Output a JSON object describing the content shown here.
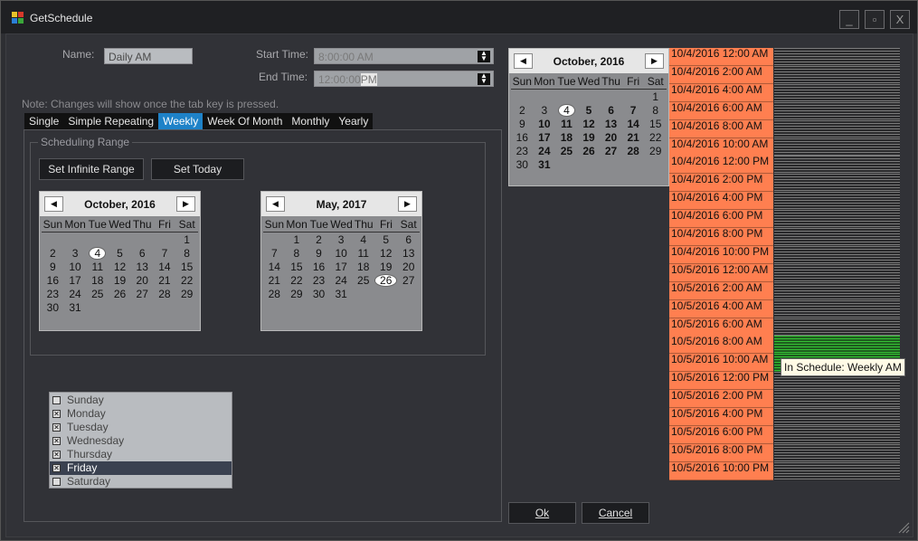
{
  "window": {
    "title": "GetSchedule",
    "minimize": "_",
    "restore": "▫",
    "close": "X"
  },
  "form": {
    "name_label": "Name:",
    "name_value": "Daily AM",
    "start_label": "Start Time:",
    "start_value": "8:00:00 AM",
    "end_label": "End Time:",
    "end_value": "12:00:00",
    "end_suffix": "PM",
    "note": "Note:  Changes will show once the tab key is pressed."
  },
  "tabs": [
    "Single",
    "Simple Repeating",
    "Weekly",
    "Week Of Month",
    "Monthly",
    "Yearly"
  ],
  "active_tab": "Weekly",
  "range": {
    "group_label": "Scheduling Range",
    "infinite_button": "Set Infinite Range",
    "today_button": "Set Today"
  },
  "dow": [
    "Sun",
    "Mon",
    "Tue",
    "Wed",
    "Thu",
    "Fri",
    "Sat"
  ],
  "calendars": {
    "start": {
      "title": "October, 2016",
      "days": [
        "",
        "",
        "",
        "",
        "",
        "",
        "1",
        "2",
        "3",
        "4",
        "5",
        "6",
        "7",
        "8",
        "9",
        "10",
        "11",
        "12",
        "13",
        "14",
        "15",
        "16",
        "17",
        "18",
        "19",
        "20",
        "21",
        "22",
        "23",
        "24",
        "25",
        "26",
        "27",
        "28",
        "29",
        "30",
        "31"
      ],
      "today": "4"
    },
    "end": {
      "title": "May, 2017",
      "days": [
        "",
        "1",
        "2",
        "3",
        "4",
        "5",
        "6",
        "7",
        "8",
        "9",
        "10",
        "11",
        "12",
        "13",
        "14",
        "15",
        "16",
        "17",
        "18",
        "19",
        "20",
        "21",
        "22",
        "23",
        "24",
        "25",
        "26",
        "27",
        "28",
        "29",
        "30",
        "31"
      ],
      "today": "26"
    },
    "preview": {
      "title": "October, 2016",
      "days": [
        "",
        "",
        "",
        "",
        "",
        "",
        "1",
        "2",
        "3",
        "4",
        "5",
        "6",
        "7",
        "8",
        "9",
        "10",
        "11",
        "12",
        "13",
        "14",
        "15",
        "16",
        "17",
        "18",
        "19",
        "20",
        "21",
        "22",
        "23",
        "24",
        "25",
        "26",
        "27",
        "28",
        "29",
        "30",
        "31"
      ],
      "today": "4",
      "bold": [
        "5",
        "6",
        "7",
        "10",
        "11",
        "12",
        "13",
        "14",
        "17",
        "18",
        "19",
        "20",
        "21",
        "24",
        "25",
        "26",
        "27",
        "28",
        "31"
      ]
    }
  },
  "weekdays": [
    {
      "label": "Sunday",
      "checked": false
    },
    {
      "label": "Monday",
      "checked": true
    },
    {
      "label": "Tuesday",
      "checked": true
    },
    {
      "label": "Wednesday",
      "checked": true
    },
    {
      "label": "Thursday",
      "checked": true
    },
    {
      "label": "Friday",
      "checked": true,
      "selected": true
    },
    {
      "label": "Saturday",
      "checked": false
    }
  ],
  "timeline": {
    "slots": [
      "10/4/2016 12:00 AM",
      "10/4/2016 2:00 AM",
      "10/4/2016 4:00 AM",
      "10/4/2016 6:00 AM",
      "10/4/2016 8:00 AM",
      "10/4/2016 10:00 AM",
      "10/4/2016 12:00 PM",
      "10/4/2016 2:00 PM",
      "10/4/2016 4:00 PM",
      "10/4/2016 6:00 PM",
      "10/4/2016 8:00 PM",
      "10/4/2016 10:00 PM",
      "10/5/2016 12:00 AM",
      "10/5/2016 2:00 AM",
      "10/5/2016 4:00 AM",
      "10/5/2016 6:00 AM",
      "10/5/2016 8:00 AM",
      "10/5/2016 10:00 AM",
      "10/5/2016 12:00 PM",
      "10/5/2016 2:00 PM",
      "10/5/2016 4:00 PM",
      "10/5/2016 6:00 PM",
      "10/5/2016 8:00 PM",
      "10/5/2016 10:00 PM"
    ],
    "in_schedule": [
      "10/5/2016 8:00 AM",
      "10/5/2016 10:00 AM"
    ],
    "tooltip": "In Schedule: Weekly AM"
  },
  "buttons": {
    "ok": "Ok",
    "cancel": "Cancel"
  },
  "colors": {
    "slot": "#ff7f50",
    "active_tab": "#1e82c8",
    "in_schedule": "#35c135"
  }
}
